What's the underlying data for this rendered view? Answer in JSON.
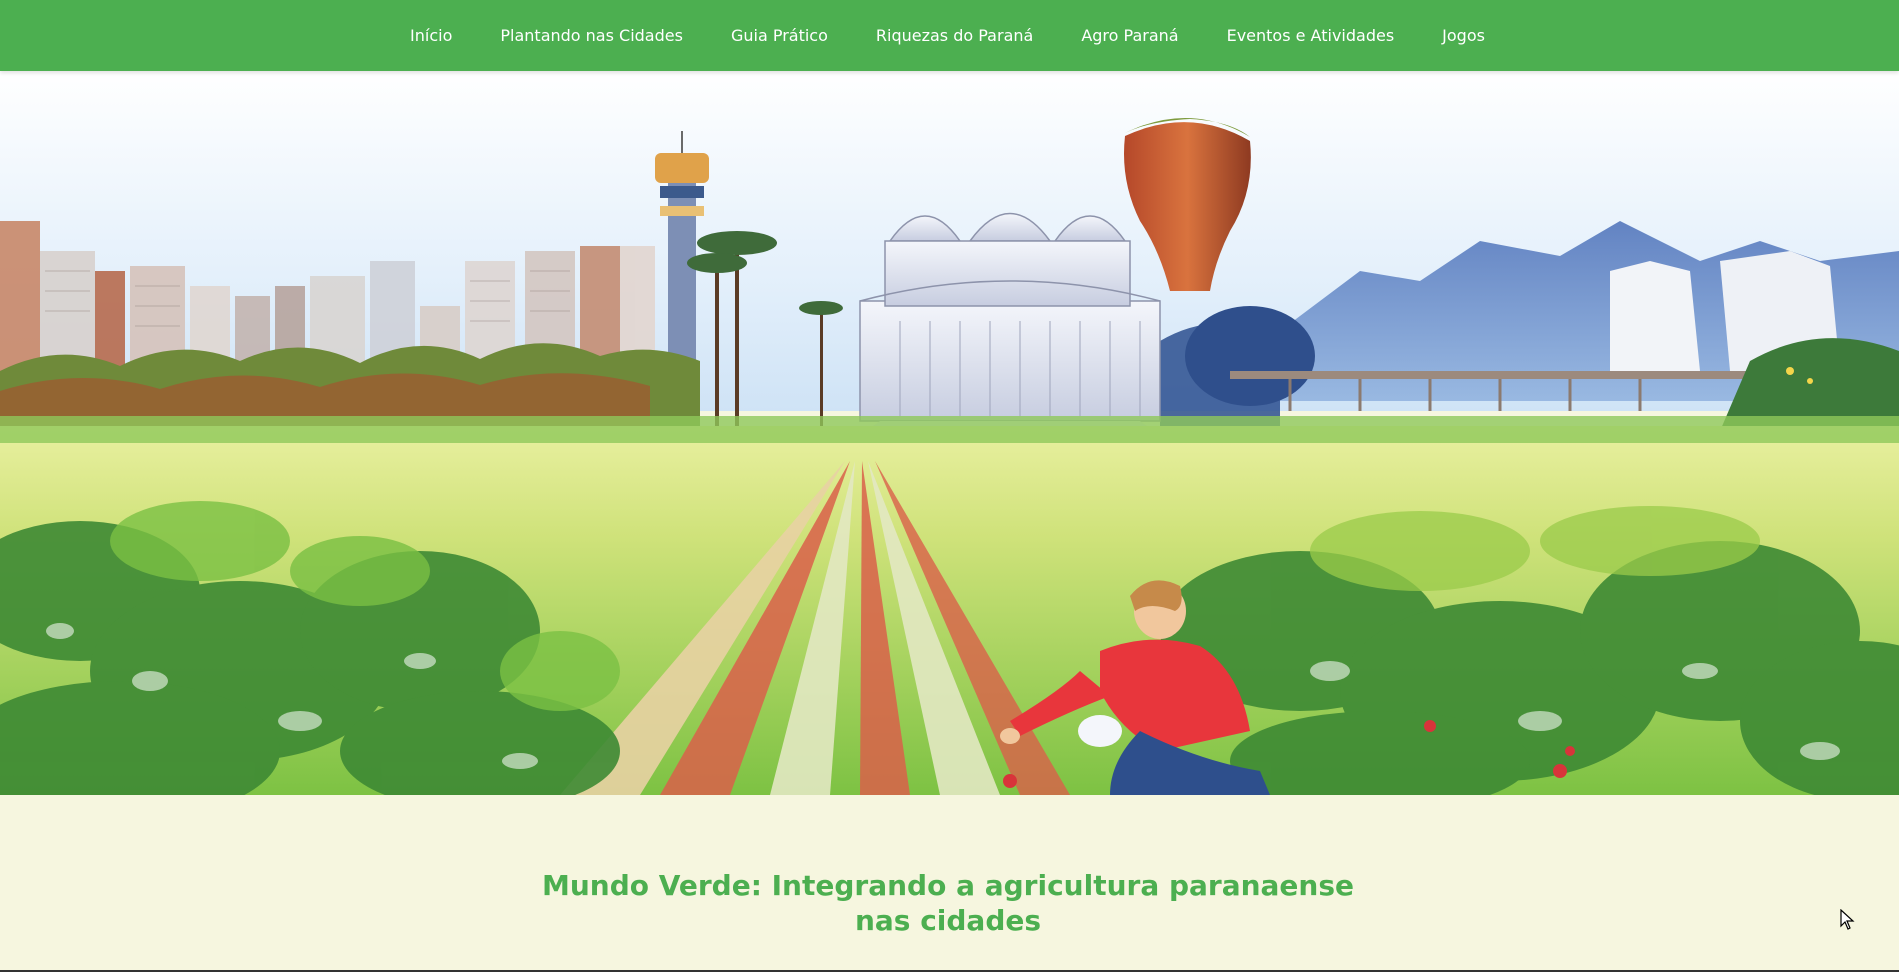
{
  "nav": {
    "items": [
      {
        "label": "Início"
      },
      {
        "label": "Plantando nas Cidades"
      },
      {
        "label": "Guia Prático"
      },
      {
        "label": "Riquezas do Paraná"
      },
      {
        "label": "Agro Paraná"
      },
      {
        "label": "Eventos e Atividades"
      },
      {
        "label": "Jogos"
      }
    ]
  },
  "main": {
    "title": "Mundo Verde: Integrando a agricultura paranaense nas cidades"
  },
  "colors": {
    "nav_bg": "#4caf50",
    "title": "#4caf50",
    "page_bg": "#f6f6df"
  }
}
